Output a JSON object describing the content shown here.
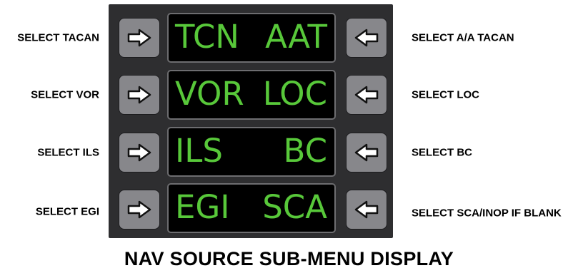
{
  "left_labels": [
    "SELECT TACAN",
    "SELECT VOR",
    "SELECT ILS",
    "SELECT EGI"
  ],
  "right_labels": [
    "SELECT A/A TACAN",
    "SELECT LOC",
    "SELECT BC",
    "SELECT SCA/INOP IF BLANK"
  ],
  "displays": [
    {
      "left": "TCN",
      "right": "AAT"
    },
    {
      "left": "VOR",
      "right": "LOC"
    },
    {
      "left": "ILS",
      "right": "BC"
    },
    {
      "left": "EGI",
      "right": "SCA"
    }
  ],
  "caption": "NAV SOURCE SUB-MENU DISPLAY",
  "colors": {
    "panel": "#2e2e30",
    "display_text": "#58c83a",
    "button": "#87878b",
    "arrow": "#ffffff"
  },
  "icons": {
    "left_button": "arrow-right-icon",
    "right_button": "arrow-left-icon"
  }
}
